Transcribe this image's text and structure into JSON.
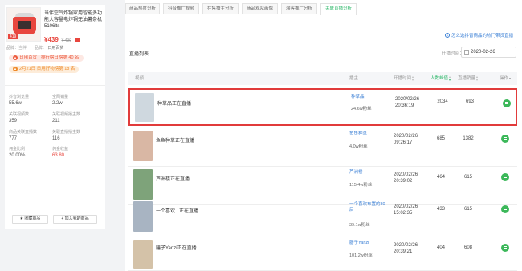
{
  "product": {
    "title": "当伴空气炸锅家用智能多功能大容量电炸锅无油薯条机5106lts",
    "image_tag": "419",
    "price": "¥439",
    "old_price": "¥ 499",
    "brand_label": "品牌：当伴",
    "brand_value": "",
    "category_label": "品牌：",
    "category_value": "日用百货",
    "rank1": "日用百货 · 排行榜日榜第 40 名",
    "rank2": "2月21日 日用好物榜第 18 名",
    "rank_icons": [
      "fire-icon",
      "fire-icon"
    ]
  },
  "stats": [
    {
      "label": "抖音浏览量",
      "value": "55.6w"
    },
    {
      "label": "全网销量",
      "value": "2.2w"
    },
    {
      "label": "关联视频数",
      "value": "359"
    },
    {
      "label": "关联视频播主数",
      "value": "211"
    },
    {
      "label": "商品关联直播数",
      "value": "777"
    },
    {
      "label": "关联直播播主数",
      "value": "116"
    },
    {
      "label": "佣金比例",
      "value": "20.00%"
    },
    {
      "label": "佣金收益",
      "value": "63.80"
    }
  ],
  "buttons": {
    "favorite": "★ 收藏商品",
    "add_mine": "+ 加入我的商品"
  },
  "tabs": [
    {
      "label": "商品热度分析",
      "active": false
    },
    {
      "label": "抖音推广视频",
      "active": false
    },
    {
      "label": "在售播主分析",
      "active": false
    },
    {
      "label": "商品观众画像",
      "active": false
    },
    {
      "label": "淘客推广分析",
      "active": false
    },
    {
      "label": "关联直播分析",
      "active": true
    }
  ],
  "help_text": "怎么选抖音商品的热门带货直播",
  "list_title": "直播列表",
  "date": {
    "label": "开播时间：",
    "value": "2020-02-26"
  },
  "columns": {
    "video": "视频",
    "host": "播主",
    "start_time": "开播时间",
    "viewers": "人数峰值",
    "sales": "直播销量",
    "action": "操作"
  },
  "rows": [
    {
      "name": "种草品正在直播",
      "host": "种草品",
      "fans": "24.6w粉丝",
      "date": "2020/02/26",
      "time": "20:36:19",
      "viewers": "2034",
      "sales": "693",
      "thumb": "#cfd8df",
      "highlight": true
    },
    {
      "name": "鱼鱼种草正在直播",
      "host": "鱼鱼种草",
      "fans": "4.0w粉丝",
      "date": "2020/02/26",
      "time": "09:26:17",
      "viewers": "685",
      "sales": "1382",
      "thumb": "#d9b7a4",
      "highlight": false
    },
    {
      "name": "芦洲楼正在直播",
      "host": "芦洲楼",
      "fans": "115.4w粉丝",
      "date": "2020/02/26",
      "time": "20:39:02",
      "viewers": "464",
      "sales": "615",
      "thumb": "#7ea37a",
      "highlight": false
    },
    {
      "name": "一个喜欢...正在直播",
      "host": "一个喜欢布置的80后",
      "fans": "39.1w粉丝",
      "date": "2020/02/26",
      "time": "15:02:35",
      "viewers": "433",
      "sales": "615",
      "thumb": "#a8b4c2",
      "highlight": false
    },
    {
      "name": "膳子Yanzi正在直播",
      "host": "膳子Yanzi",
      "fans": "101.2w粉丝",
      "date": "2020/02/26",
      "time": "20:39:21",
      "viewers": "404",
      "sales": "608",
      "thumb": "#d4c2a8",
      "highlight": false
    }
  ]
}
